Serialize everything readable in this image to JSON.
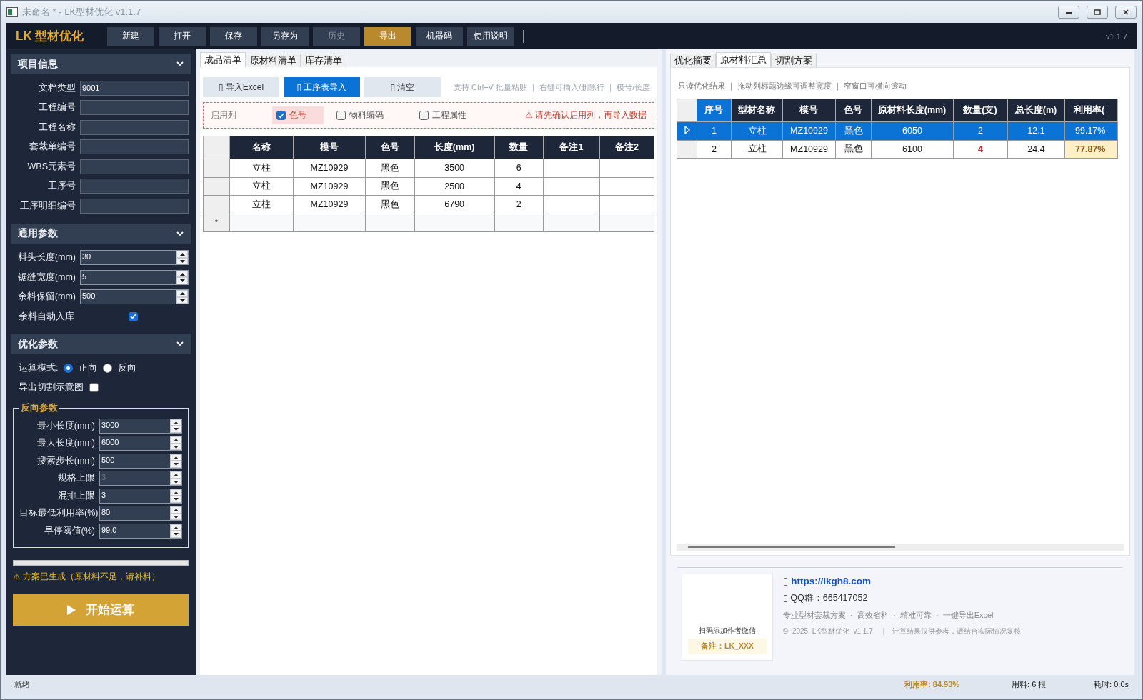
{
  "window": {
    "title": "未命名 * - LK型材优化 v1.1.7"
  },
  "toolbar": {
    "logo": "LK 型材优化",
    "version": "v1.1.7",
    "buttons": [
      {
        "label": "新建",
        "selected": false,
        "disabled": false
      },
      {
        "label": "打开",
        "selected": false,
        "disabled": false
      },
      {
        "label": "保存",
        "selected": false,
        "disabled": false
      },
      {
        "label": "另存为",
        "selected": false,
        "disabled": false
      },
      {
        "label": "历史",
        "selected": false,
        "disabled": true
      },
      {
        "label": "导出",
        "selected": true,
        "disabled": false
      },
      {
        "label": "机器码",
        "selected": false,
        "disabled": false
      },
      {
        "label": "使用说明",
        "selected": false,
        "disabled": false
      }
    ]
  },
  "sidebar": {
    "project": {
      "title": "项目信息",
      "expanded": true,
      "fields": [
        {
          "label": "文档类型",
          "value": "9001"
        },
        {
          "label": "工程编号"
        },
        {
          "label": "工程名称"
        },
        {
          "label": "套裁单编号"
        },
        {
          "label": "WBS元素号"
        },
        {
          "label": "工序号"
        },
        {
          "label": "工序明细编号"
        }
      ]
    },
    "general": {
      "title": "通用参数",
      "expanded": true,
      "fields": [
        {
          "label": "料头长度(mm)",
          "value": "30",
          "disabled": false
        },
        {
          "label": "锯缝宽度(mm)",
          "value": "5",
          "disabled": false
        },
        {
          "label": "余料保留(mm)",
          "value": "500",
          "disabled": false
        }
      ],
      "auto_stock": {
        "label": "余料自动入库",
        "checked": true
      }
    },
    "optimize": {
      "title": "优化参数",
      "expanded": true,
      "mode": {
        "label": "运算模式:",
        "options": [
          {
            "label": "正向",
            "selected": true
          },
          {
            "label": "反向",
            "selected": false
          }
        ]
      },
      "export_diagram": {
        "label": "导出切割示意图",
        "checked": false
      },
      "reverse": {
        "title": "反向参数",
        "fields": [
          {
            "label": "最小长度(mm)",
            "value": "3000",
            "disabled": false
          },
          {
            "label": "最大长度(mm)",
            "value": "6000",
            "disabled": false
          },
          {
            "label": "搜索步长(mm)",
            "value": "500",
            "disabled": false
          },
          {
            "label": "规格上限",
            "value": "3",
            "disabled": true
          },
          {
            "label": "混排上限",
            "value": "3",
            "disabled": false
          },
          {
            "label": "目标最低利用率(%)",
            "value": "80",
            "disabled": false
          },
          {
            "label": "早停阈值(%)",
            "value": "99.0",
            "disabled": false
          }
        ]
      }
    },
    "progress": {
      "level": 0
    },
    "message": "⚠ 方案已生成（原材料不足，请补料）",
    "run_button": {
      "label": "开始运算"
    }
  },
  "products": {
    "tabs": [
      {
        "label": "成品清单",
        "selected": true
      },
      {
        "label": "原材料清单",
        "selected": false
      },
      {
        "label": "库存清单",
        "selected": false
      }
    ],
    "actions": [
      {
        "label": "▯ 导入Excel",
        "selected": false
      },
      {
        "label": "▯ 工序表导入",
        "selected": true
      },
      {
        "label": "▯ 清空",
        "selected": false
      }
    ],
    "hint": "支持 Ctrl+V 批量粘贴 ｜ 右键可插入/删除行 ｜ 模号/长度",
    "enable_columns": {
      "label": "启用列",
      "options": [
        {
          "label": "色号",
          "checked": true
        },
        {
          "label": "物料编码",
          "checked": false
        },
        {
          "label": "工程属性",
          "checked": false
        }
      ],
      "warning": "⚠ 请先确认启用列，再导入数据"
    },
    "table": {
      "columns": [
        "名称",
        "模号",
        "色号",
        "长度(mm)",
        "数量",
        "备注1",
        "备注2"
      ],
      "rows": [
        [
          "立柱",
          "MZ10929",
          "黑色",
          "3500",
          "6"
        ],
        [
          "立柱",
          "MZ10929",
          "黑色",
          "2500",
          "4"
        ],
        [
          "立柱",
          "MZ10929",
          "黑色",
          "6790",
          "2"
        ]
      ],
      "new_row_marker": "*"
    }
  },
  "results": {
    "tabs": [
      {
        "label": "优化摘要",
        "selected": false
      },
      {
        "label": "原材料汇总",
        "selected": true
      },
      {
        "label": "切割方案",
        "selected": false
      }
    ],
    "hint": "只读优化结果 ｜ 拖动列标题边缘可调整宽度 ｜ 窄窗口可横向滚动",
    "table": {
      "columns": [
        "序号",
        "型材名称",
        "模号",
        "色号",
        "原材料长度(mm)",
        "数量(支)",
        "总长度(m)",
        "利用率("
      ],
      "rows": [
        {
          "selected": true,
          "cells": [
            {
              "v": "1"
            },
            {
              "v": "立柱"
            },
            {
              "v": "MZ10929"
            },
            {
              "v": "黑色"
            },
            {
              "v": "6050"
            },
            {
              "v": "2"
            },
            {
              "v": "12.1"
            },
            {
              "v": "99.17%"
            }
          ]
        },
        {
          "selected": false,
          "cells": [
            {
              "v": "2"
            },
            {
              "v": "立柱"
            },
            {
              "v": "MZ10929"
            },
            {
              "v": "黑色"
            },
            {
              "v": "6100"
            },
            {
              "v": "4",
              "kind": "alert"
            },
            {
              "v": "24.4"
            },
            {
              "v": "77.87%",
              "kind": "warn"
            }
          ]
        }
      ]
    },
    "footer": {
      "qr_caption": "扫码添加作者微信",
      "qr_note": "备注：LK_XXX",
      "link": "▯ https://lkgh8.com",
      "qq": "▯ QQ群：665417052",
      "tagline": "专业型材套裁方案  ·  高效省料  ·  精准可靠  ·  一键导出Excel",
      "copyright": "©  2025  LK型材优化  v1.1.7     |    计算结果仅供参考，请结合实际情况复核"
    }
  },
  "status_bar": {
    "state": "就绪",
    "utilization": "利用率: 84.93%",
    "material": "用料: 6 根",
    "time": "耗时: 0.0s"
  }
}
